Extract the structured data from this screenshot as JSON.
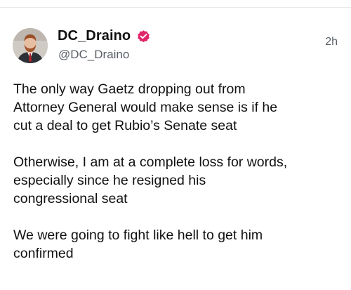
{
  "post": {
    "display_name": "DC_Draino",
    "handle": "@DC_Draino",
    "timestamp": "2h",
    "verified": true,
    "paragraphs": [
      "The only way Gaetz dropping out from\nAttorney General would make sense is if he\ncut a deal to get Rubio’s Senate seat",
      "Otherwise, I am at a complete loss for words,\nespecially since he resigned his\ncongressional seat",
      "We were going to fight like hell to get him\nconfirmed"
    ]
  },
  "colors": {
    "text": "#111111",
    "secondary_text": "#5b6068",
    "verified_badge": "#e0246a",
    "divider": "#e6e8eb"
  }
}
